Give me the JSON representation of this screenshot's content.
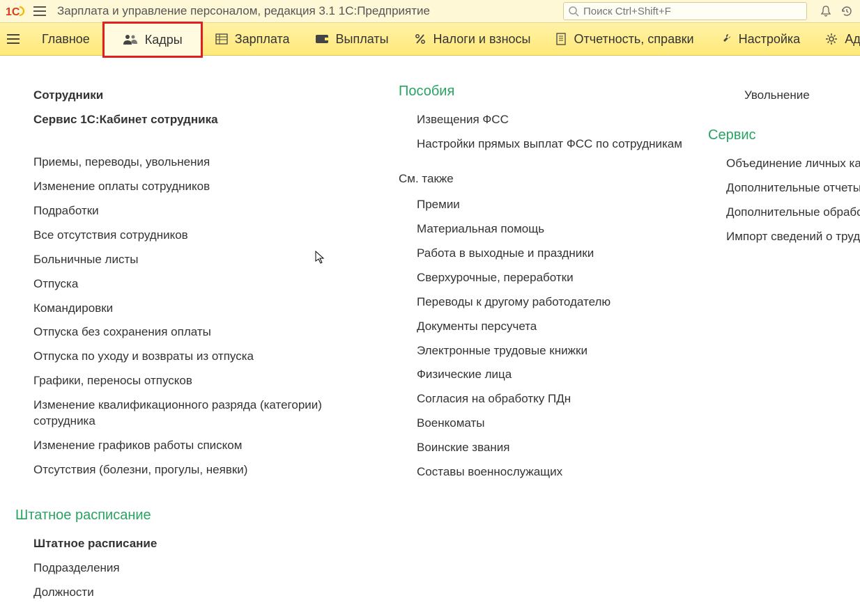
{
  "header": {
    "app_title": "Зарплата и управление персоналом, редакция 3.1 1С:Предприятие",
    "search_placeholder": "Поиск Ctrl+Shift+F"
  },
  "nav": {
    "main": "Главное",
    "personnel": "Кадры",
    "salary": "Зарплата",
    "payments": "Выплаты",
    "taxes": "Налоги и взносы",
    "reports": "Отчетность, справки",
    "settings": "Настройка",
    "admin": "Администрир"
  },
  "col1": {
    "employees": "Сотрудники",
    "employee_cabinet": "Сервис 1С:Кабинет сотрудника",
    "hires": "Приемы, переводы, увольнения",
    "pay_changes": "Изменение оплаты сотрудников",
    "extra_work": "Подработки",
    "all_absences": "Все отсутствия сотрудников",
    "sick_leave": "Больничные листы",
    "vacations": "Отпуска",
    "business_trips": "Командировки",
    "unpaid_vacations": "Отпуска без сохранения оплаты",
    "childcare_leave": "Отпуска по уходу и возвраты из отпуска",
    "vacation_schedules": "Графики, переносы отпусков",
    "qualification_change": "Изменение квалификационного разряда (категории) сотрудника",
    "work_schedule_change": "Изменение графиков работы списком",
    "absences": "Отсутствия (болезни, прогулы, неявки)",
    "staffing_h": "Штатное расписание",
    "staffing": "Штатное расписание",
    "departments": "Подразделения",
    "positions": "Должности"
  },
  "col2": {
    "benefits_h": "Пособия",
    "fss_notify": "Извещения ФСС",
    "fss_settings": "Настройки прямых выплат ФСС по сотрудникам",
    "see_also_h": "См. также",
    "bonuses": "Премии",
    "material_aid": "Материальная помощь",
    "holiday_work": "Работа в выходные и праздники",
    "overtime": "Сверхурочные, переработки",
    "transfers": "Переводы к другому работодателю",
    "recalc_docs": "Документы персучета",
    "ework_books": "Электронные трудовые книжки",
    "persons": "Физические лица",
    "pdn_consent": "Согласия на обработку ПДн",
    "military_offices": "Военкоматы",
    "military_ranks": "Воинские звания",
    "military_lists": "Составы военнослужащих"
  },
  "col3": {
    "dismissal": "Увольнение",
    "service_h": "Сервис",
    "merge_cards": "Объединение личных карточек",
    "extra_reports": "Дополнительные отчеты",
    "extra_processing": "Дополнительные обработки",
    "import_labor": "Импорт сведений о трудовой де"
  }
}
